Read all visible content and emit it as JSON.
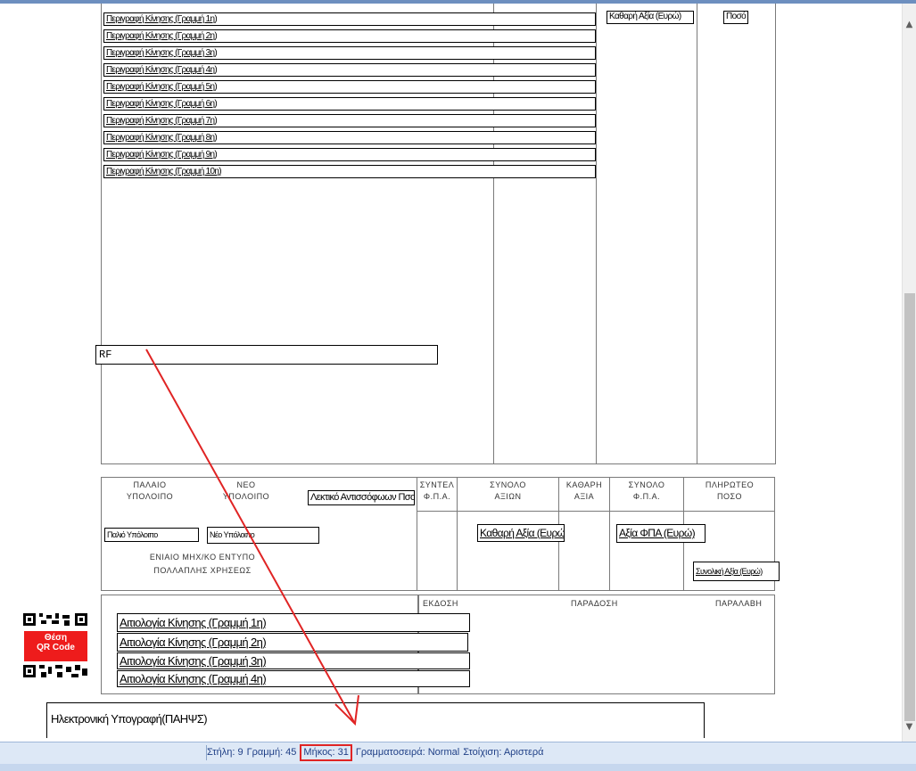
{
  "main": {
    "header_net_value": "Καθαρή Αξία (Ευρώ)",
    "header_amount": "Ποσό",
    "item_rows": [
      "Περιγραφή Κίνησης (Γραμμή 1η)",
      "Περιγραφή Κίνησης (Γραμμή 2η)",
      "Περιγραφή Κίνησης (Γραμμή 3η)",
      "Περιγραφή Κίνησης (Γραμμή 4η)",
      "Περιγραφή Κίνησης (Γραμμή 5η)",
      "Περιγραφή Κίνησης (Γραμμή 6η)",
      "Περιγραφή Κίνησης (Γραμμή 7η)",
      "Περιγραφή Κίνησης (Γραμμή 8η)",
      "Περιγραφή Κίνησης (Γραμμή 9η)",
      "Περιγραφή Κίνησης (Γραμμή 10η)"
    ],
    "rf_field": "RF"
  },
  "totals": {
    "old_balance_label_1": "ΠΑΛΑΙΟ",
    "old_balance_label_2": "ΥΠΟΛΟΙΠΟ",
    "new_balance_label_1": "ΝΕΟ",
    "new_balance_label_2": "ΥΠΟΛΟΙΠΟ",
    "words_field": "Λεκτικό Αντισσόφωων Πσο",
    "old_balance_field": "Παλιό Υπόλοιπο",
    "new_balance_field": "Νέο Υπόλοιπο",
    "form_note_1": "ΕΝΙΑΙΟ ΜΗΧ/ΚΟ ΕΝΤΥΠΟ",
    "form_note_2": "ΠΟΛΛΑΠΛΗΣ ΧΡΗΣΕΩΣ",
    "col_fpa_total_1": "ΣΥΝΤΕΛ",
    "col_fpa_total_2": "Φ.Π.Α.",
    "col_values_total_1": "ΣΥΝΟΛΟ",
    "col_values_total_2": "ΑΞΙΩΝ",
    "col_net_1": "ΚΑΘΑΡΗ",
    "col_net_2": "ΑΞΙΑ",
    "col_vat_total_1": "ΣΥΝΟΛΟ",
    "col_vat_total_2": "Φ.Π.Α.",
    "col_payable_1": "ΠΛΗΡΩΤΕΟ",
    "col_payable_2": "ΠΟΣΟ",
    "net_value_field": "Καθαρή Αξία (Ευρώ)",
    "vat_value_field": "Αξία ΦΠΑ (Ευρώ)",
    "total_value_field": "Συνολική Αξία (Ευρώ)"
  },
  "footer": {
    "qr_badge_line1": "Θέση",
    "qr_badge_line2": "QR Code",
    "dispatch_rows": [
      "Αιτιολογία Κίνησης (Γραμμή 1η)",
      "Αιτιολογία Κίνησης (Γραμμή 2η)",
      "Αιτιολογία Κίνησης (Γραμμή 3η)",
      "Αιτιολογία Κίνησης (Γραμμή 4η)"
    ],
    "issue_label": "ΕΚΔΟΣΗ",
    "delivery_label": "ΠΑΡΑΔΟΣΗ",
    "receipt_label": "ΠΑΡΑΛΑΒΗ",
    "signature_field": "Ηλεκτρονική Υπογραφή(ΠΑΗΨΣ)"
  },
  "status_bar": {
    "column": "Στήλη: 9",
    "line": "Γραμμή: 45",
    "length": "Μήκος: 31",
    "font": "Γραμματοσειρά: Normal",
    "alignment": "Στοίχιση: Αριστερά"
  },
  "scrollbar": {
    "up_icon": "▲",
    "down_icon": "▼"
  },
  "colors": {
    "annotation": "#e02424",
    "status_text": "#1f3f86",
    "qr_badge": "#ee1c1c"
  }
}
